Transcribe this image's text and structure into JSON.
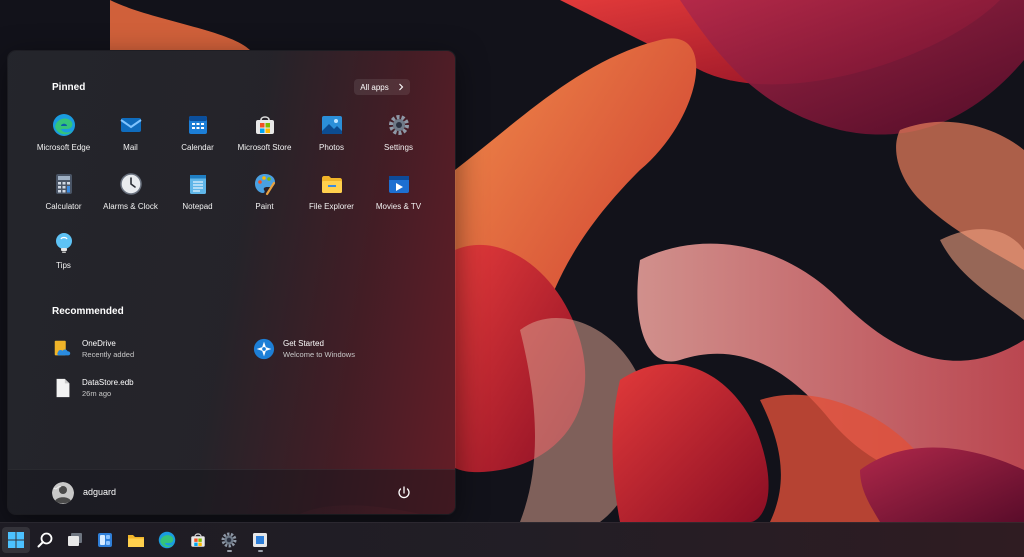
{
  "start_menu": {
    "pinned_title": "Pinned",
    "all_apps_label": "All apps",
    "pinned": [
      {
        "label": "Microsoft Edge",
        "icon": "edge-icon"
      },
      {
        "label": "Mail",
        "icon": "mail-icon"
      },
      {
        "label": "Calendar",
        "icon": "calendar-icon"
      },
      {
        "label": "Microsoft Store",
        "icon": "store-icon"
      },
      {
        "label": "Photos",
        "icon": "photos-icon"
      },
      {
        "label": "Settings",
        "icon": "settings-icon"
      },
      {
        "label": "Calculator",
        "icon": "calculator-icon"
      },
      {
        "label": "Alarms & Clock",
        "icon": "clock-icon"
      },
      {
        "label": "Notepad",
        "icon": "notepad-icon"
      },
      {
        "label": "Paint",
        "icon": "paint-icon"
      },
      {
        "label": "File Explorer",
        "icon": "folder-icon"
      },
      {
        "label": "Movies & TV",
        "icon": "movies-icon"
      },
      {
        "label": "Tips",
        "icon": "tips-icon"
      }
    ],
    "recommended_title": "Recommended",
    "recommended": [
      {
        "title": "OneDrive",
        "subtitle": "Recently added",
        "icon": "onedrive-icon"
      },
      {
        "title": "Get Started",
        "subtitle": "Welcome to Windows",
        "icon": "get-started-icon"
      },
      {
        "title": "DataStore.edb",
        "subtitle": "26m ago",
        "icon": "file-icon"
      }
    ],
    "user": {
      "name": "adguard"
    }
  },
  "taskbar": {
    "items": [
      "start-icon",
      "search-icon",
      "task-view-icon",
      "widgets-icon",
      "file-explorer-icon",
      "edge-icon",
      "store-icon",
      "settings-icon",
      "app-window-icon"
    ]
  },
  "colors": {
    "accent": "#0078d4",
    "wallpaper_dark": "#12121a",
    "ribbon_red": "#c8182e",
    "ribbon_orange": "#e8703a"
  }
}
